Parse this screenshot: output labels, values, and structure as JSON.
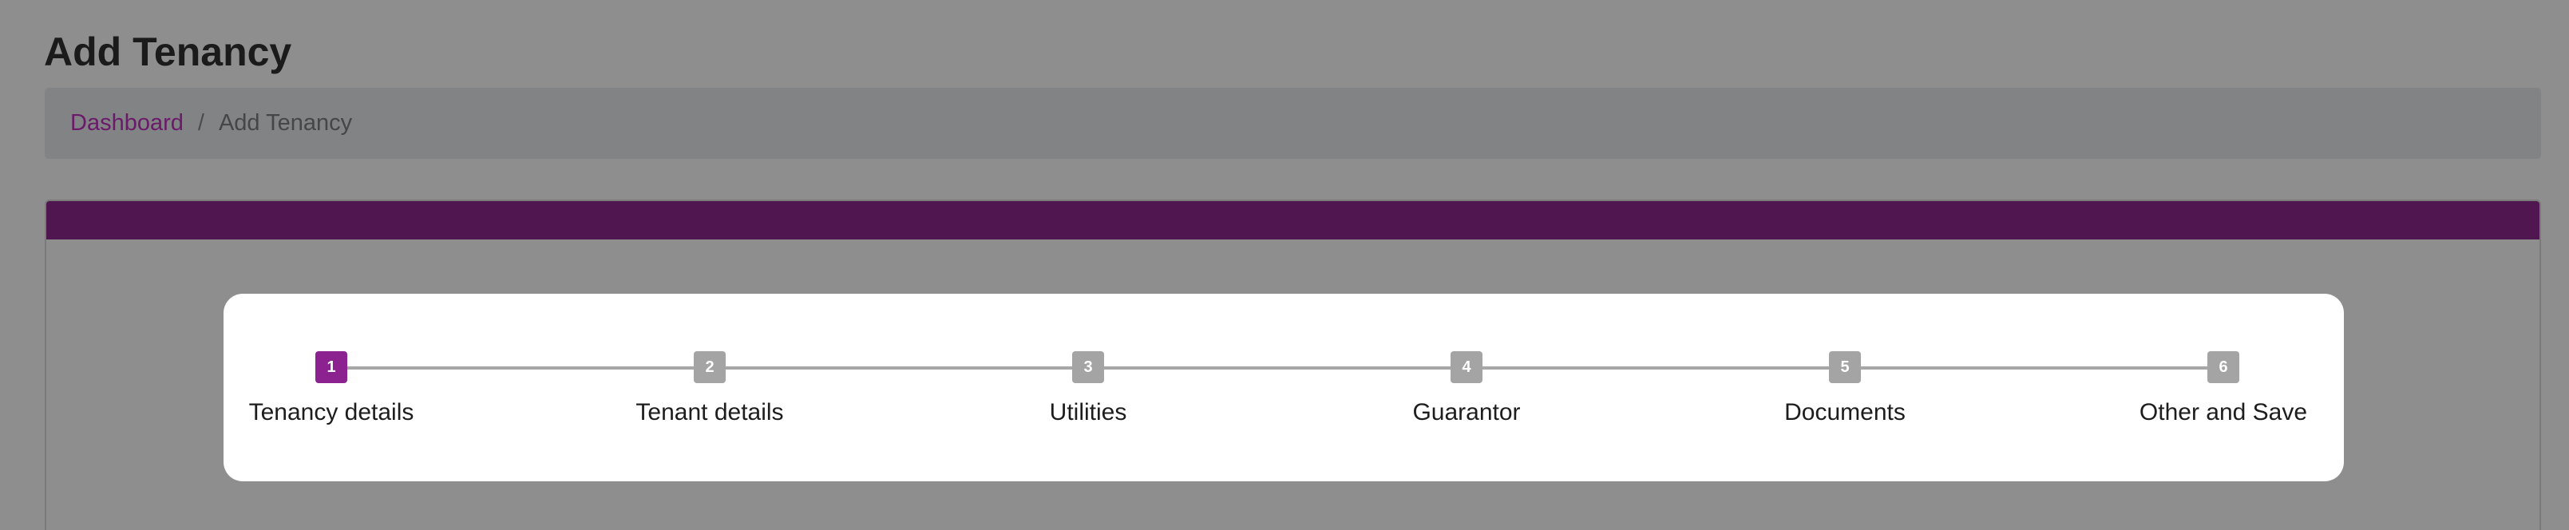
{
  "page": {
    "title": "Add Tenancy"
  },
  "breadcrumb": {
    "home": "Dashboard",
    "separator": "/",
    "current": "Add Tenancy"
  },
  "colors": {
    "accent": "#8b2290",
    "header_bar": "#501650",
    "link": "#6b1a6a",
    "step_inactive": "#a4a4a4"
  },
  "stepper": {
    "current_step": 1,
    "steps": [
      {
        "number": "1",
        "label": "Tenancy details"
      },
      {
        "number": "2",
        "label": "Tenant details"
      },
      {
        "number": "3",
        "label": "Utilities"
      },
      {
        "number": "4",
        "label": "Guarantor"
      },
      {
        "number": "5",
        "label": "Documents"
      },
      {
        "number": "6",
        "label": "Other and Save"
      }
    ]
  }
}
